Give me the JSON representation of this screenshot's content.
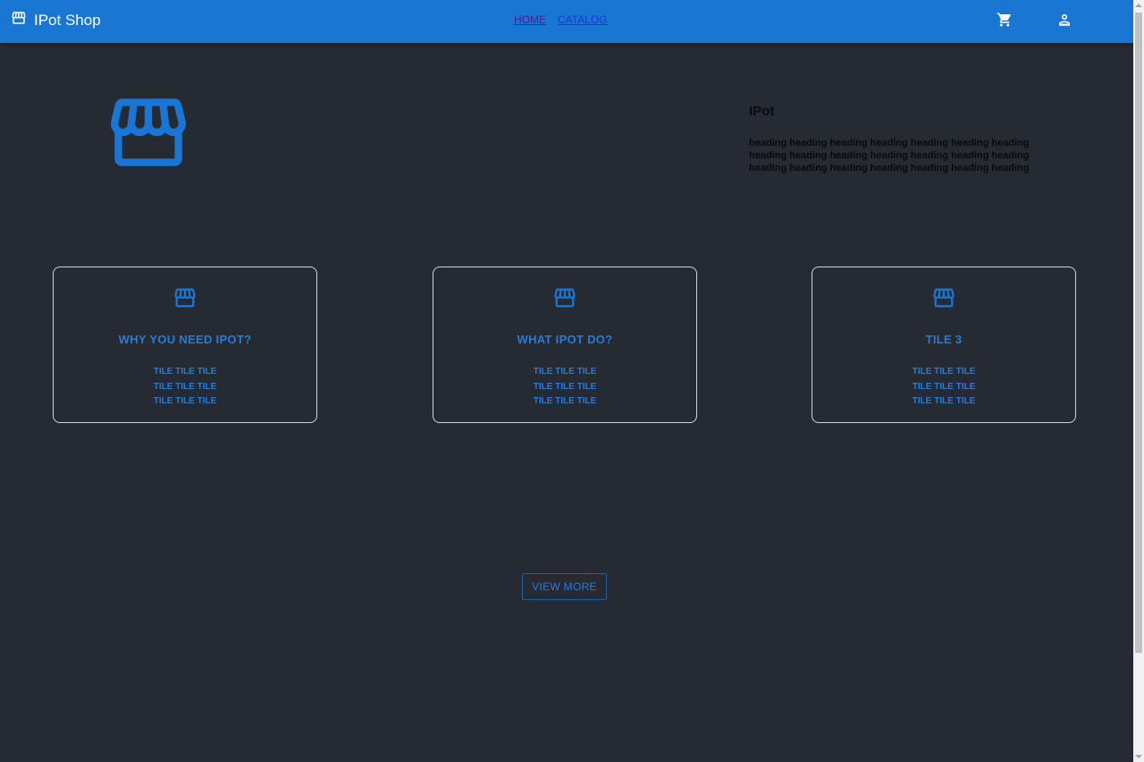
{
  "header": {
    "brand": "IPot Shop",
    "brand_icon": "storefront-icon",
    "nav": [
      {
        "label": "HOME"
      },
      {
        "label": "CATALOG"
      }
    ],
    "cart_icon": "shopping-cart-icon",
    "account_icon": "person-icon"
  },
  "hero": {
    "icon": "storefront-icon",
    "title": "IPot",
    "body": "heading heading heading heading heading heading heading heading heading heading heading heading heading heading heading heading heading heading heading heading heading"
  },
  "tiles": [
    {
      "title": "WHY YOU NEED IPOT?",
      "lines": [
        "TILE TILE TILE",
        "TILE TILE TILE",
        "TILE TILE TILE"
      ]
    },
    {
      "title": "WHAT IPOT DO?",
      "lines": [
        "TILE TILE TILE",
        "TILE TILE TILE",
        "TILE TILE TILE"
      ]
    },
    {
      "title": "TILE 3",
      "lines": [
        "TILE TILE TILE",
        "TILE TILE TILE",
        "TILE TILE TILE"
      ]
    }
  ],
  "view_more_label": "VIEW MORE",
  "colors": {
    "appbar": "#1976d2",
    "background": "#262a33",
    "accent": "#2a7bd6"
  }
}
